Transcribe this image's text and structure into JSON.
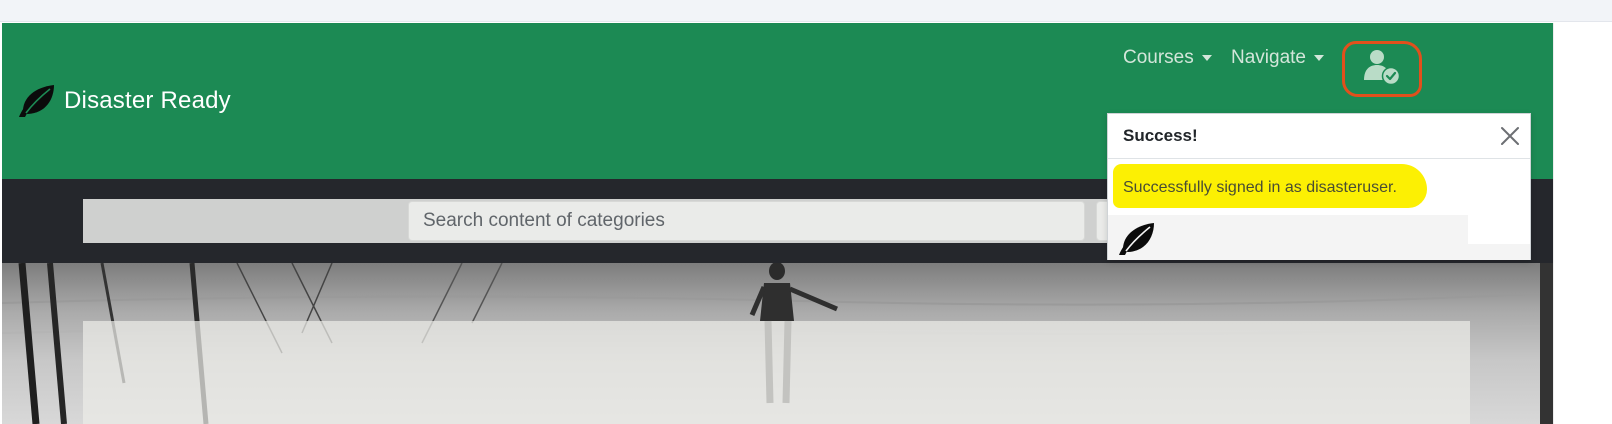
{
  "brand": {
    "name": "Disaster Ready",
    "logo_icon": "leaf-icon"
  },
  "nav": {
    "courses_label": "Courses",
    "navigate_label": "Navigate",
    "user_icon": "user-check-icon"
  },
  "search": {
    "placeholder": "Search content of categories"
  },
  "toast": {
    "title": "Success!",
    "message": "Successfully signed in as disasteruser.",
    "close_icon": "close-icon",
    "footer_icon": "leaf-icon"
  },
  "colors": {
    "header_bg": "#1c8a54",
    "search_region_bg": "#25272c",
    "annotation_circle": "#e2501c",
    "annotation_highlight": "#fcf003"
  }
}
